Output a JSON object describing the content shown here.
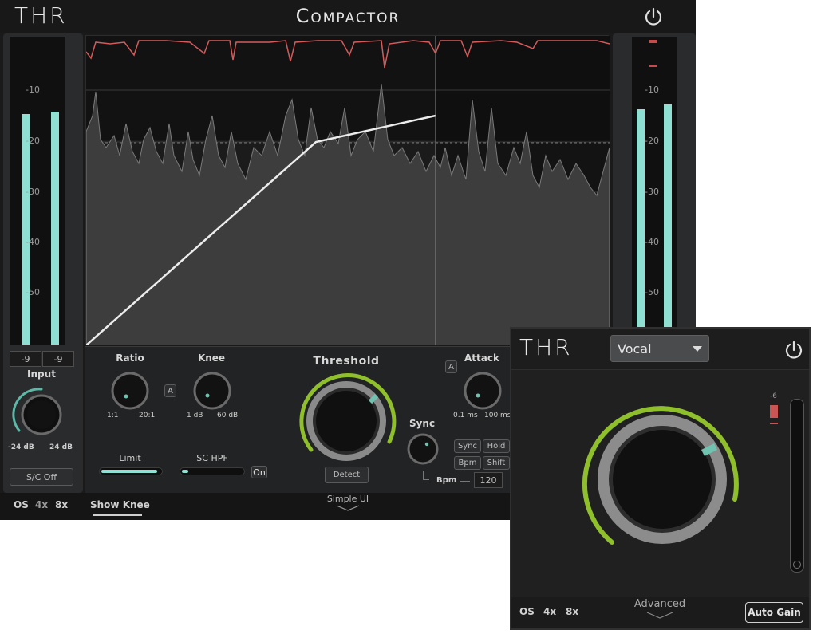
{
  "main": {
    "logo": "THR",
    "title": "Compactor",
    "power_icon": "power-icon",
    "graph": {
      "db_labels": [
        "-10",
        "-20",
        "-30",
        "-40",
        "-50"
      ]
    },
    "input_meter": {
      "scale": [
        "-10",
        "-20",
        "-30",
        "-40",
        "-50"
      ],
      "readout_l": "-9",
      "readout_r": "-9",
      "knob_label": "Input",
      "min_label": "-24 dB",
      "max_label": "24 dB",
      "sc_button": "S/C Off",
      "level_l": 0.89,
      "level_r": 0.9
    },
    "output_meter": {
      "scale": [
        "-10",
        "-20",
        "-30",
        "-40",
        "-50"
      ],
      "level_l": 0.88,
      "level_r": 0.9
    },
    "controls": {
      "ratio": {
        "label": "Ratio",
        "min": "1:1",
        "max": "20:1"
      },
      "ratio_auto": "A",
      "knee": {
        "label": "Knee",
        "min": "1 dB",
        "max": "60 dB"
      },
      "threshold": {
        "label": "Threshold",
        "detect_button": "Detect"
      },
      "sync": {
        "label": "Sync"
      },
      "attack": {
        "label": "Attack",
        "min": "0.1 ms",
        "max": "100 ms"
      },
      "attack_auto": "A",
      "limit": {
        "label": "Limit",
        "value": 0.95
      },
      "sc_hpf": {
        "label": "SC HPF",
        "on_button": "On",
        "value": 0.1
      },
      "sync_buttons": [
        "Sync",
        "Hold",
        "Bpm",
        "Shift"
      ],
      "bpm_label": "Bpm",
      "bpm_value": "120"
    },
    "bottom": {
      "os_label": "OS",
      "os_4x": "4x",
      "os_8x": "8x",
      "show_knee": "Show Knee",
      "simple_ui": "Simple UI"
    }
  },
  "simple": {
    "logo": "THR",
    "preset": "Vocal",
    "power_icon": "power-icon",
    "meter_label": "-6",
    "bottom": {
      "os_label": "OS",
      "os_4x": "4x",
      "os_8x": "8x",
      "advanced": "Advanced",
      "auto_gain": "Auto Gain"
    }
  },
  "colors": {
    "meter_cyan": "#8fe0d2",
    "knob_green": "#8fbf2a",
    "curve_red": "#d45b5b",
    "indicator_teal": "#6fc3b0"
  }
}
